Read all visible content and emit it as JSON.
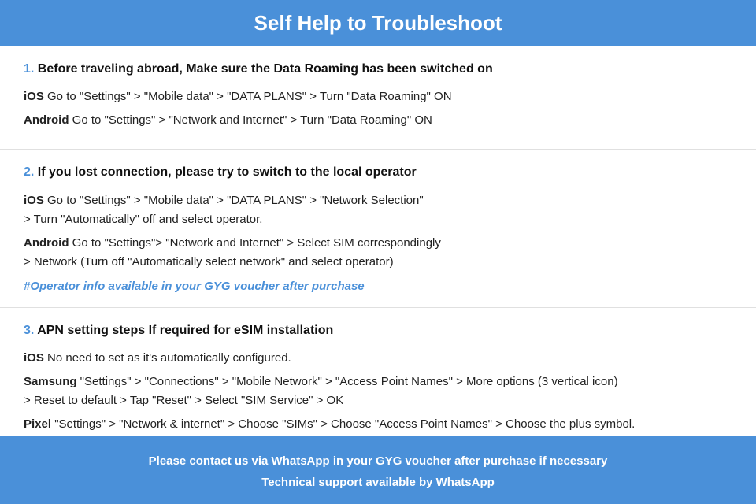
{
  "header": {
    "title": "Self Help to Troubleshoot"
  },
  "sections": [
    {
      "number": "1.",
      "title": "Before traveling abroad, Make sure the Data Roaming has been switched on",
      "items": [
        {
          "platform": "iOS",
          "text": "Go to \"Settings\" > \"Mobile data\" > \"DATA PLANS\" > Turn \"Data Roaming\" ON"
        },
        {
          "platform": "Android",
          "text": "Go to \"Settings\" > \"Network and Internet\" > Turn \"Data Roaming\" ON"
        }
      ],
      "link": null
    },
    {
      "number": "2.",
      "title": "If you lost connection, please try to switch to the local operator",
      "items": [
        {
          "platform": "iOS",
          "text": "Go to \"Settings\" > \"Mobile data\" > \"DATA PLANS\" > \"Network Selection\"\n> Turn \"Automatically\" off and select operator."
        },
        {
          "platform": "Android",
          "text": "Go to \"Settings\">  \"Network and Internet\" > Select SIM correspondingly\n> Network (Turn off \"Automatically select network\" and select operator)"
        }
      ],
      "link": "#Operator info available in your GYG voucher after purchase"
    },
    {
      "number": "3.",
      "title": "APN setting steps If required for eSIM installation",
      "items": [
        {
          "platform": "iOS",
          "text": "No need to set as it's automatically configured."
        },
        {
          "platform": "Samsung",
          "text": "\"Settings\" > \"Connections\" > \"Mobile Network\" > \"Access Point Names\" > More options (3 vertical icon)\n> Reset to default > Tap \"Reset\" > Select \"SIM Service\" > OK"
        },
        {
          "platform": "Pixel",
          "text": "\"Settings\" > \"Network & internet\" > Choose \"SIMs\" > Choose \"Access Point Names\" > Choose the plus symbol."
        }
      ],
      "link": null
    }
  ],
  "footer": {
    "line1": "Please contact us via WhatsApp  in your GYG voucher after purchase if necessary",
    "line2": "Technical support available by WhatsApp"
  }
}
